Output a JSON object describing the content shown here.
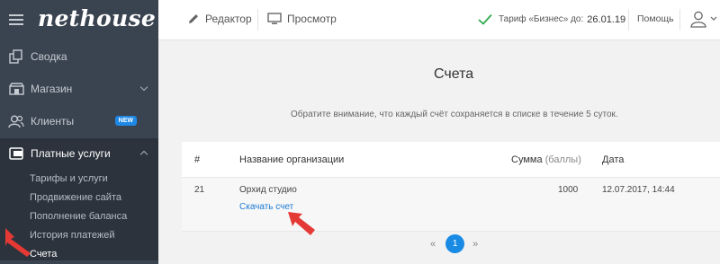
{
  "sidebar": {
    "logo": "nethouse",
    "items": [
      {
        "label": "Сводка",
        "icon": "copy-icon"
      },
      {
        "label": "Магазин",
        "icon": "store-icon"
      },
      {
        "label": "Клиенты",
        "icon": "users-icon",
        "badge": "NEW"
      },
      {
        "label": "Платные услуги",
        "icon": "wallet-icon"
      }
    ],
    "submenu": [
      "Тарифы и услуги",
      "Продвижение сайта",
      "Пополнение баланса",
      "История платежей",
      "Счета"
    ]
  },
  "topbar": {
    "editor": "Редактор",
    "preview": "Просмотр",
    "tariff_label": "Тариф «Бизнес» до:",
    "tariff_date": "26.01.19",
    "help": "Помощь"
  },
  "main": {
    "title": "Счета",
    "notice": "Обратите внимание, что каждый счёт сохраняется в списке в течение 5 суток.",
    "table": {
      "headers": {
        "num": "#",
        "org": "Название организации",
        "sum": "Сумма",
        "sum_unit": "(баллы)",
        "date": "Дата"
      },
      "rows": [
        {
          "num": "21",
          "org": "Орхид студио",
          "sum": "1000",
          "date": "12.07.2017, 14:44",
          "link": "Скачать счет"
        }
      ]
    },
    "pagination": {
      "prev": "«",
      "current": "1",
      "next": "»"
    }
  },
  "colors": {
    "sidebar": "#3a4350",
    "accent": "#1a8be5",
    "annotation": "#e53935",
    "check": "#2eaa4a"
  }
}
